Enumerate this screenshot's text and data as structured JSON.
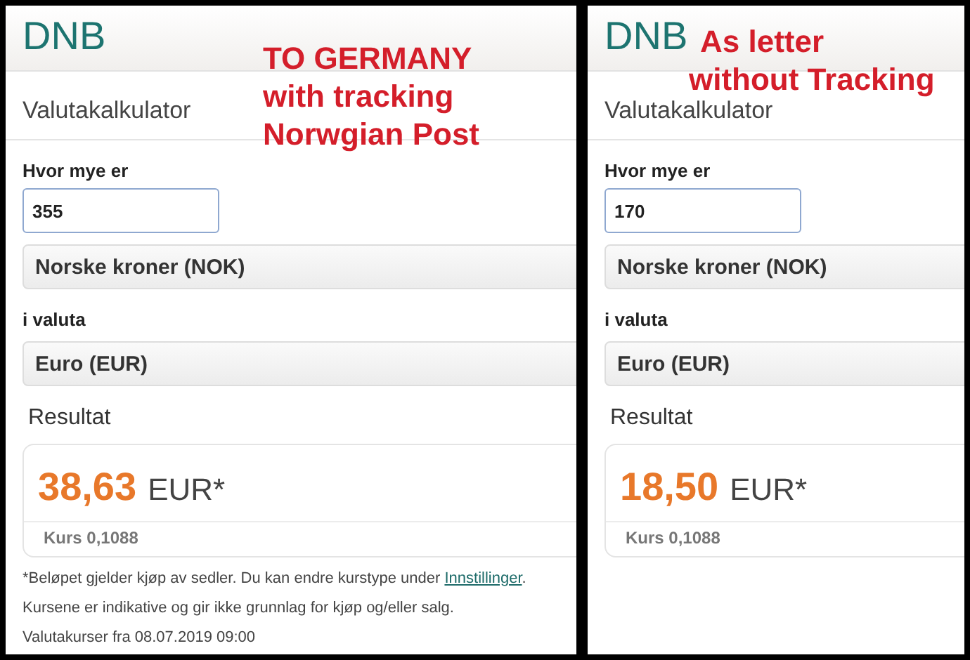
{
  "panels": [
    {
      "logo": "DNB",
      "title": "Valutakalkulator",
      "amount_label": "Hvor mye er",
      "amount": "355",
      "from_currency": "Norske kroner (NOK)",
      "to_label": "i valuta",
      "to_currency": "Euro (EUR)",
      "result_label": "Resultat",
      "result_amount": "38,63",
      "result_currency": "EUR*",
      "rate": "Kurs 0,1088",
      "footnote": {
        "text": "*Beløpet gjelder kjøp av sedler. Du kan endre kurstype under ",
        "link": "Innstillinger",
        "end": "."
      },
      "notes": [
        "Kursene er indikative og gir ikke grunnlag for kjøp og/eller salg.",
        "Valutakurser fra 08.07.2019 09:00"
      ],
      "annotation": [
        "TO GERMANY",
        "with tracking",
        "Norwgian Post"
      ]
    },
    {
      "logo": "DNB",
      "title": "Valutakalkulator",
      "amount_label": "Hvor mye er",
      "amount": "170",
      "from_currency": "Norske kroner (NOK)",
      "to_label": "i valuta",
      "to_currency": "Euro (EUR)",
      "result_label": "Resultat",
      "result_amount": "18,50",
      "result_currency": "EUR*",
      "rate": "Kurs 0,1088",
      "annotation": [
        "As letter",
        "without Tracking"
      ]
    }
  ]
}
